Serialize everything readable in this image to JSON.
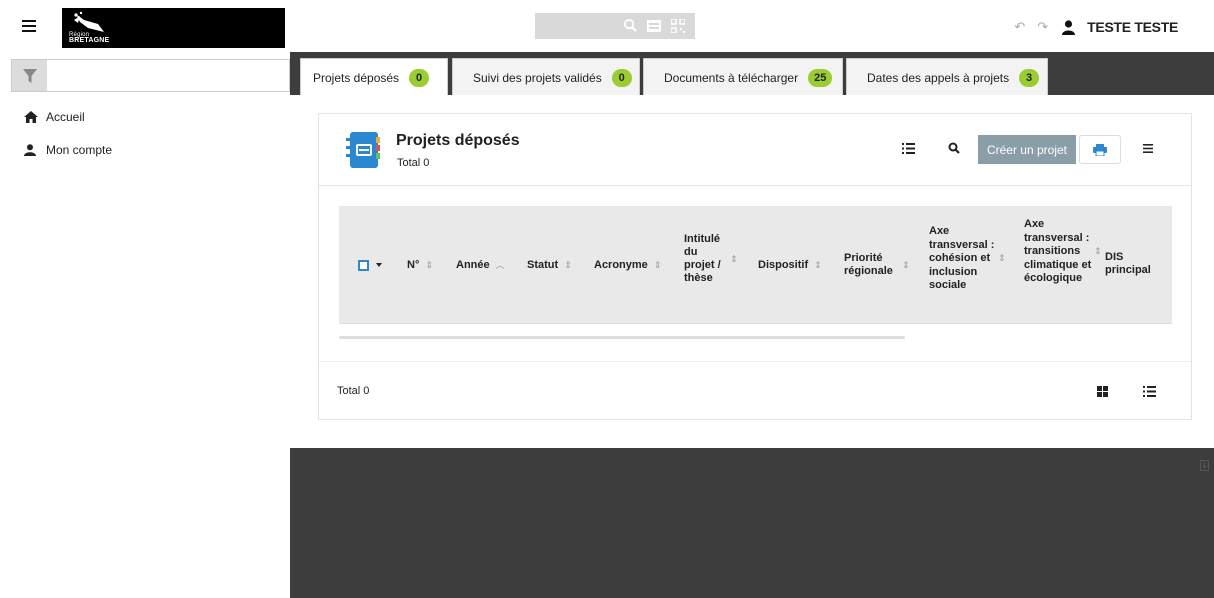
{
  "header": {
    "logo_text_small": "Région",
    "logo_text_big": "BRETAGNE",
    "user_name": "TESTE TESTE"
  },
  "sidebar": {
    "items": [
      {
        "label": "Accueil",
        "icon": "home-icon"
      },
      {
        "label": "Mon compte",
        "icon": "user-icon"
      }
    ]
  },
  "tabs": [
    {
      "label": "Projets déposés",
      "count": "0"
    },
    {
      "label": "Suivi des projets validés",
      "count": "0"
    },
    {
      "label": "Documents à télécharger",
      "count": "25"
    },
    {
      "label": "Dates des appels à projets",
      "count": "3"
    }
  ],
  "card": {
    "title": "Projets déposés",
    "total": "Total 0",
    "create_label": "Créer un projet",
    "footer_total": "Total 0"
  },
  "table": {
    "columns": [
      {
        "label": "N°"
      },
      {
        "label": "Année"
      },
      {
        "label": "Statut"
      },
      {
        "label": "Acronyme"
      },
      {
        "label": "Intitulé du projet / thèse"
      },
      {
        "label": "Dispositif"
      },
      {
        "label": "Priorité régionale"
      },
      {
        "label": "Axe transversal : cohésion et inclusion sociale"
      },
      {
        "label": "Axe transversal : transitions climatique et écologique"
      },
      {
        "label": "DIS principal"
      }
    ]
  },
  "colors": {
    "badge": "#9acd32",
    "main_bg": "#3d3d3d",
    "create_button": "#8a9ea8",
    "book_icon": "#2a87d0"
  }
}
